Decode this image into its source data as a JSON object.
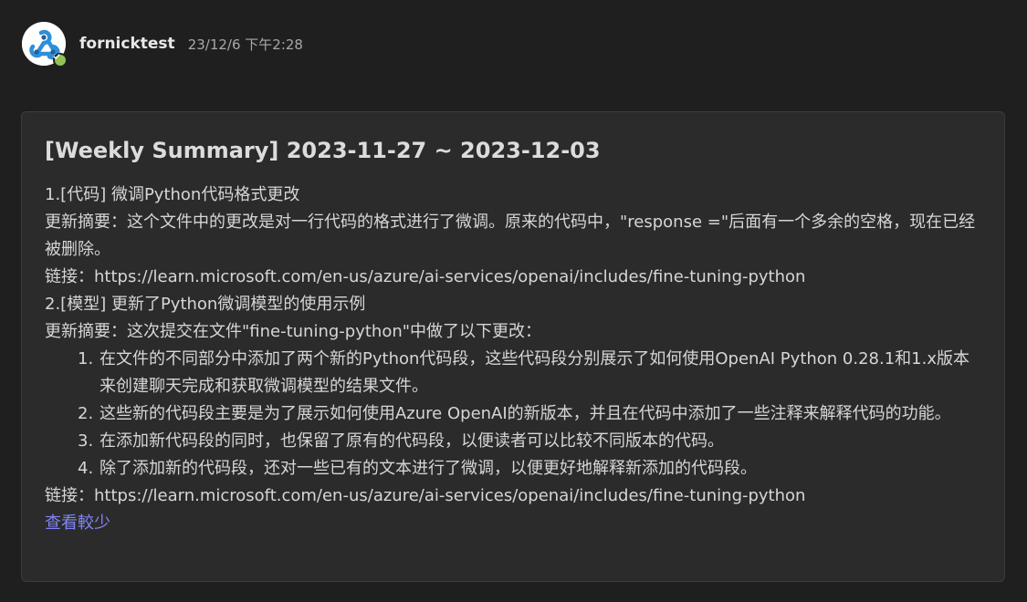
{
  "header": {
    "sender": "fornicktest",
    "timestamp": "23/12/6 下午2:28"
  },
  "card": {
    "title": "[Weekly Summary] 2023-11-27 ~ 2023-12-03",
    "item1": {
      "heading": "1.[代码] 微调Python代码格式更改",
      "summary": "更新摘要：这个文件中的更改是对一行代码的格式进行了微调。原来的代码中，\"response =\"后面有一个多余的空格，现在已经被删除。",
      "link": "链接：https://learn.microsoft.com/en-us/azure/ai-services/openai/includes/fine-tuning-python"
    },
    "item2": {
      "heading": "2.[模型] 更新了Python微调模型的使用示例",
      "summary": "更新摘要：这次提交在文件\"fine-tuning-python\"中做了以下更改：",
      "changes": [
        {
          "num": "1.",
          "text": "在文件的不同部分中添加了两个新的Python代码段，这些代码段分别展示了如何使用OpenAI Python 0.28.1和1.x版本来创建聊天完成和获取微调模型的结果文件。"
        },
        {
          "num": "2.",
          "text": "这些新的代码段主要是为了展示如何使用Azure OpenAI的新版本，并且在代码中添加了一些注释来解释代码的功能。"
        },
        {
          "num": "3.",
          "text": "在添加新代码段的同时，也保留了原有的代码段，以便读者可以比较不同版本的代码。"
        },
        {
          "num": "4.",
          "text": "除了添加新的代码段，还对一些已有的文本进行了微调，以便更好地解释新添加的代码段。"
        }
      ],
      "link": "链接：https://learn.microsoft.com/en-us/azure/ai-services/openai/includes/fine-tuning-python"
    },
    "see_less": "查看較少"
  },
  "colors": {
    "background": "#1f1f1f",
    "card": "#2b2b2b",
    "link_accent": "#7f85f5",
    "presence": "#92c353"
  },
  "icons": {
    "avatar": "webhook-avatar-icon",
    "presence": "available-check-icon"
  }
}
